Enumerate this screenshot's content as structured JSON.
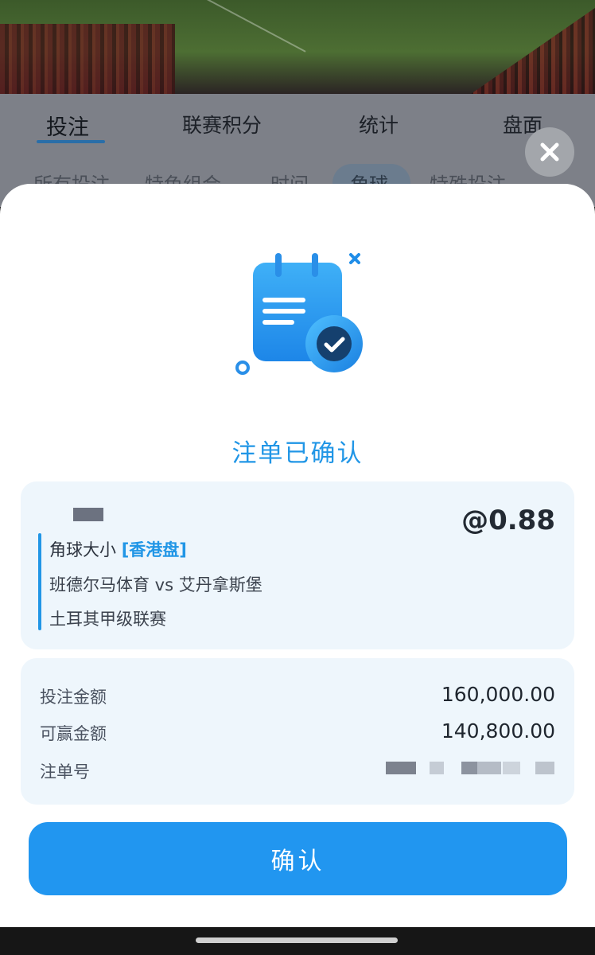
{
  "background": {
    "tabs": [
      "投注",
      "联赛积分",
      "统计",
      "盘面"
    ],
    "sub_tabs": [
      "所有投注",
      "特色组合",
      "时间",
      "角球",
      "特殊投注"
    ]
  },
  "dialog": {
    "close_icon": "close-icon",
    "illustration_icon": "notepad-check-icon",
    "title": "注单已确认",
    "selection": {
      "odds": "@0.88",
      "market": "角球大小",
      "handicap_type": "[香港盘]",
      "match": "班德尔马体育 vs 艾丹拿斯堡",
      "league": "土耳其甲级联赛"
    },
    "summary": {
      "stake_label": "投注金额",
      "stake_value": "160,000.00",
      "win_label": "可赢金额",
      "win_value": "140,800.00",
      "ticket_label": "注单号"
    },
    "confirm_button": "确认"
  },
  "colors": {
    "accent": "#2196e6",
    "card_bg": "#eef6fc",
    "button": "#2196f0"
  }
}
